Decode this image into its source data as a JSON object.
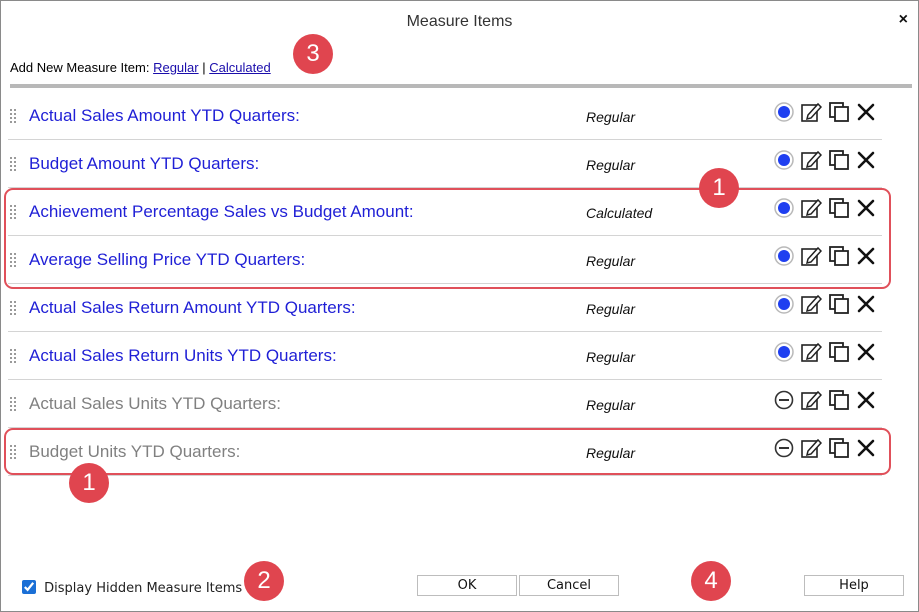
{
  "dialog": {
    "title": "Measure Items",
    "close_label": "×"
  },
  "add_new": {
    "prefix": "Add New Measure Item:",
    "regular_link": "Regular",
    "separator": "|",
    "calculated_link": "Calculated"
  },
  "items": [
    {
      "name": "Actual Sales Amount YTD Quarters:",
      "type": "Regular",
      "visible": true
    },
    {
      "name": "Budget Amount YTD Quarters:",
      "type": "Regular",
      "visible": true
    },
    {
      "name": "Achievement Percentage Sales vs Budget Amount:",
      "type": "Calculated",
      "visible": true
    },
    {
      "name": "Average Selling Price YTD Quarters:",
      "type": "Regular",
      "visible": true
    },
    {
      "name": "Actual Sales Return Amount YTD Quarters:",
      "type": "Regular",
      "visible": true
    },
    {
      "name": "Actual Sales Return Units YTD Quarters:",
      "type": "Regular",
      "visible": true
    },
    {
      "name": "Actual Sales Units YTD Quarters:",
      "type": "Regular",
      "visible": false
    },
    {
      "name": "Budget Units YTD Quarters:",
      "type": "Regular",
      "visible": false
    }
  ],
  "footer": {
    "display_hidden_label": "Display Hidden Measure Items",
    "display_hidden_checked": true,
    "ok_label": "OK",
    "cancel_label": "Cancel",
    "help_label": "Help"
  },
  "callouts": {
    "badge_1a": "1",
    "badge_1b": "1",
    "badge_2": "2",
    "badge_3": "3",
    "badge_4": "4"
  },
  "colors": {
    "visible_name": "#1f1fd6",
    "hidden_name": "#808080",
    "visible_dot": "#1f3ff0",
    "callout": "#e0454f"
  },
  "icons": {
    "visible": "visible-toggle-icon",
    "hidden": "hidden-toggle-icon",
    "edit": "edit-icon",
    "duplicate": "duplicate-icon",
    "delete": "delete-icon",
    "drag": "drag-handle-icon"
  }
}
